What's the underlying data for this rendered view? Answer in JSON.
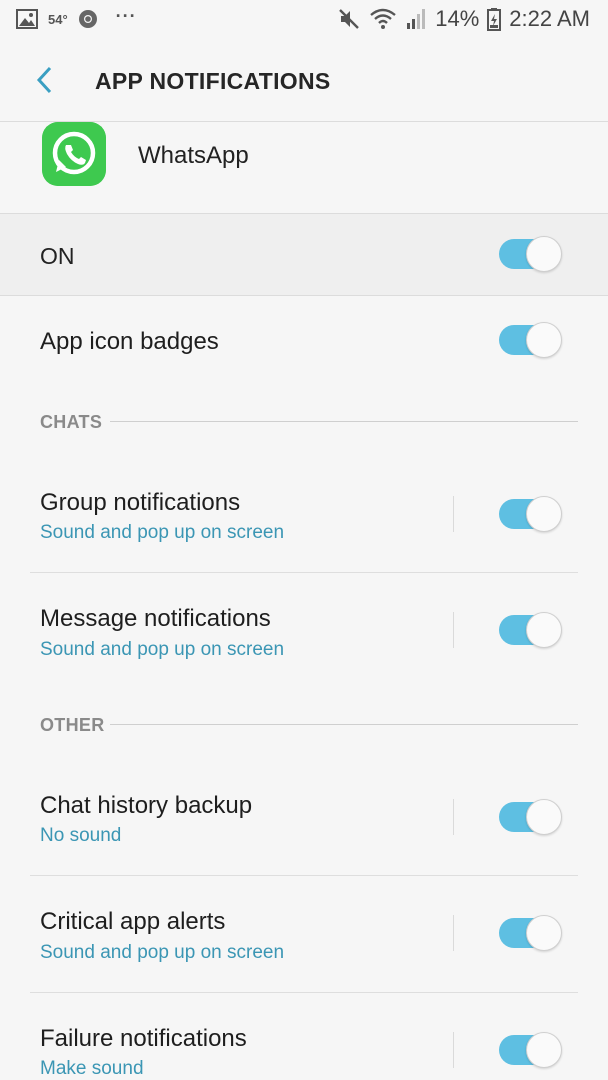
{
  "status_bar": {
    "temperature": "54°",
    "dots": "···",
    "battery": "14%",
    "time": "2:22 AM",
    "icons": [
      "image-icon",
      "chrome-icon",
      "mute-icon",
      "wifi-icon",
      "signal-icon",
      "battery-icon"
    ]
  },
  "header": {
    "title": "APP NOTIFICATIONS",
    "back_icon": "chevron-left-icon"
  },
  "app": {
    "name": "WhatsApp",
    "icon": "whatsapp-icon"
  },
  "master": {
    "label": "ON",
    "on": true
  },
  "badges": {
    "label": "App icon badges",
    "on": true
  },
  "sections": {
    "chats": "CHATS",
    "other": "OTHER"
  },
  "chats": [
    {
      "title": "Group notifications",
      "subtitle": "Sound and pop up on screen",
      "on": true
    },
    {
      "title": "Message notifications",
      "subtitle": "Sound and pop up on screen",
      "on": true
    }
  ],
  "other": [
    {
      "title": "Chat history backup",
      "subtitle": "No sound",
      "on": true
    },
    {
      "title": "Critical app alerts",
      "subtitle": "Sound and pop up on screen",
      "on": true
    },
    {
      "title": "Failure notifications",
      "subtitle": "Make sound",
      "on": true
    }
  ],
  "colors": {
    "accent": "#5ebfe2",
    "subtitle": "#3b96b4",
    "whatsapp": "#3ec94f"
  }
}
